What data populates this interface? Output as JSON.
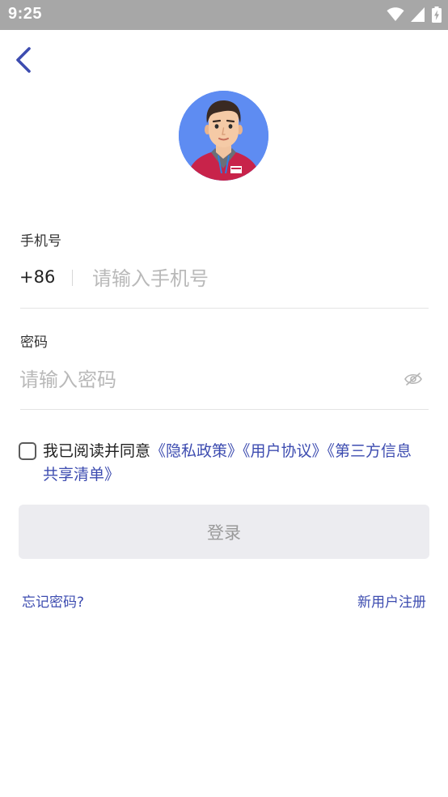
{
  "status_bar": {
    "time": "9:25",
    "icons": [
      "wifi-icon",
      "signal-icon",
      "battery-charging-icon"
    ]
  },
  "nav": {
    "back_icon": "chevron-left-icon"
  },
  "login_form": {
    "phone_label": "手机号",
    "country_code": "+86",
    "phone_placeholder": "请输入手机号",
    "phone_value": "",
    "password_label": "密码",
    "password_placeholder": "请输入密码",
    "password_value": "",
    "password_visibility_icon": "eye-off-icon"
  },
  "agreement": {
    "checked": false,
    "prefix": "我已阅读并同意",
    "privacy_policy": "《隐私政策》",
    "user_agreement": "《用户协议》",
    "third_party_list": "《第三方信息共享清单》"
  },
  "login_button_label": "登录",
  "links": {
    "forgot_password": "忘记密码?",
    "register": "新用户注册"
  },
  "colors": {
    "status_bar": "#a7a7a7",
    "accent": "#3d4cb0",
    "button_disabled_bg": "#ececf0",
    "avatar_bg": "#5e8cf2"
  }
}
